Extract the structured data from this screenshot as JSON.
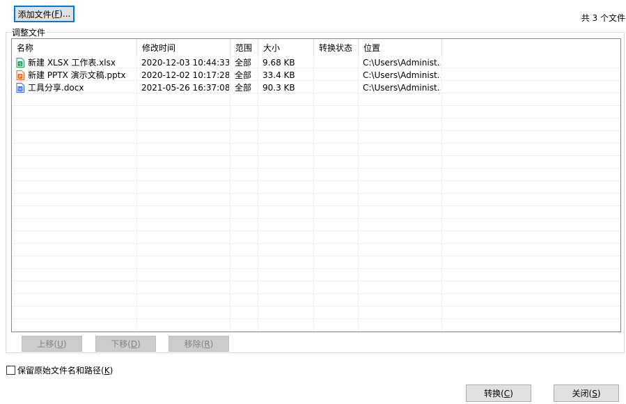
{
  "toolbar": {
    "add_file": {
      "text": "添加文件(",
      "key": "F",
      "suffix": ")..."
    },
    "file_count": "共 3 个文件"
  },
  "group": {
    "title": "调整文件"
  },
  "columns": [
    "名称",
    "修改时间",
    "范围",
    "大小",
    "转换状态",
    "位置"
  ],
  "files": [
    {
      "icon": "xlsx-file-icon",
      "icon_color": "#1f9d55",
      "icon_letter": "S",
      "name": "新建 XLSX 工作表.xlsx",
      "modified": "2020-12-03 10:44:33",
      "range": "全部",
      "size": "9.68 KB",
      "status": "",
      "location": "C:\\Users\\Administ..."
    },
    {
      "icon": "pptx-file-icon",
      "icon_color": "#e8691e",
      "icon_letter": "P",
      "name": "新建 PPTX 演示文稿.pptx",
      "modified": "2020-12-02 10:17:28",
      "range": "全部",
      "size": "33.4 KB",
      "status": "",
      "location": "C:\\Users\\Administ..."
    },
    {
      "icon": "docx-file-icon",
      "icon_color": "#2b6fd6",
      "icon_letter": "W",
      "name": "工具分享.docx",
      "modified": "2021-05-26 16:37:08",
      "range": "全部",
      "size": "90.3 KB",
      "status": "",
      "location": "C:\\Users\\Administ..."
    }
  ],
  "move_buttons": {
    "up": {
      "text": "上移(",
      "key": "U",
      "suffix": ")"
    },
    "down": {
      "text": "下移(",
      "key": "D",
      "suffix": ")"
    },
    "remove": {
      "text": "移除(",
      "key": "R",
      "suffix": ")"
    }
  },
  "keep_path": {
    "text": "保留原始文件名和路径(",
    "key": "K",
    "suffix": ")",
    "checked": false
  },
  "footer": {
    "convert": {
      "text": "转换(",
      "key": "C",
      "suffix": ")"
    },
    "close": {
      "text": "关闭(",
      "key": "S",
      "suffix": ")"
    }
  }
}
